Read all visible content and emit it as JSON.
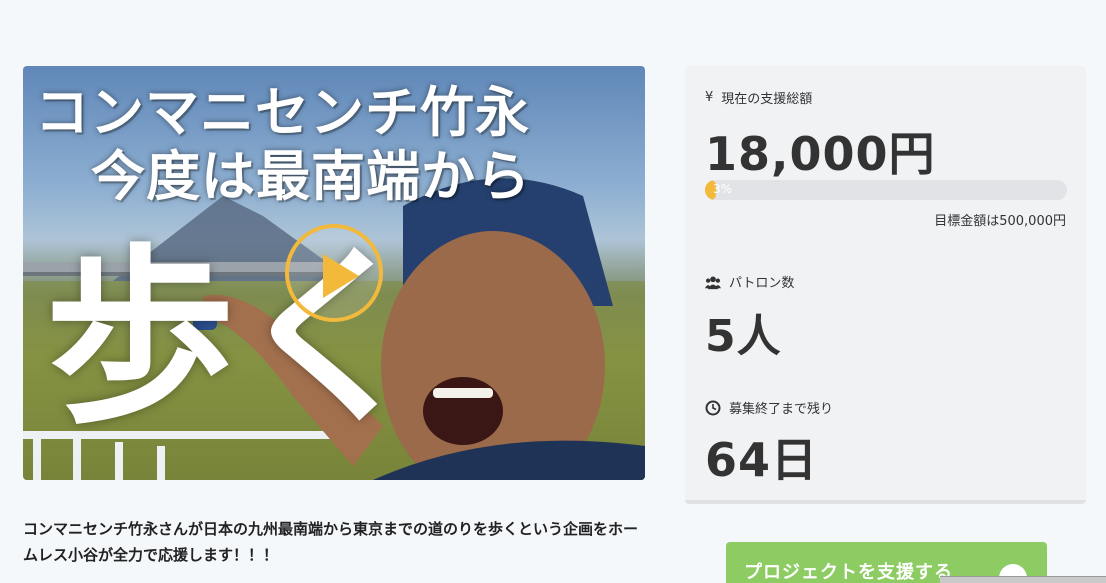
{
  "video": {
    "title_line1": "コンマニセンチ竹永",
    "title_line2": "今度は最南端から",
    "title_big": "歩く"
  },
  "description": "コンマニセンチ竹永さんが日本の九州最南端から東京までの道のりを歩くという企画をホームレス小谷が全力で応援します！！！",
  "stats": {
    "amount_label": "現在の支援総額",
    "amount_icon": "yen-icon",
    "amount_value": "18,000円",
    "progress_percent": 3,
    "progress_text": "3%",
    "goal_text": "目標金額は500,000円",
    "patrons_label": "パトロン数",
    "patrons_icon": "users-icon",
    "patrons_value": "5人",
    "remaining_label": "募集終了まで残り",
    "remaining_icon": "clock-icon",
    "remaining_value": "64日"
  },
  "support_button": {
    "label": "プロジェクトを支援する"
  },
  "colors": {
    "accent": "#f2b93b",
    "button": "#8ccc63",
    "panel": "#f0f2f4"
  }
}
